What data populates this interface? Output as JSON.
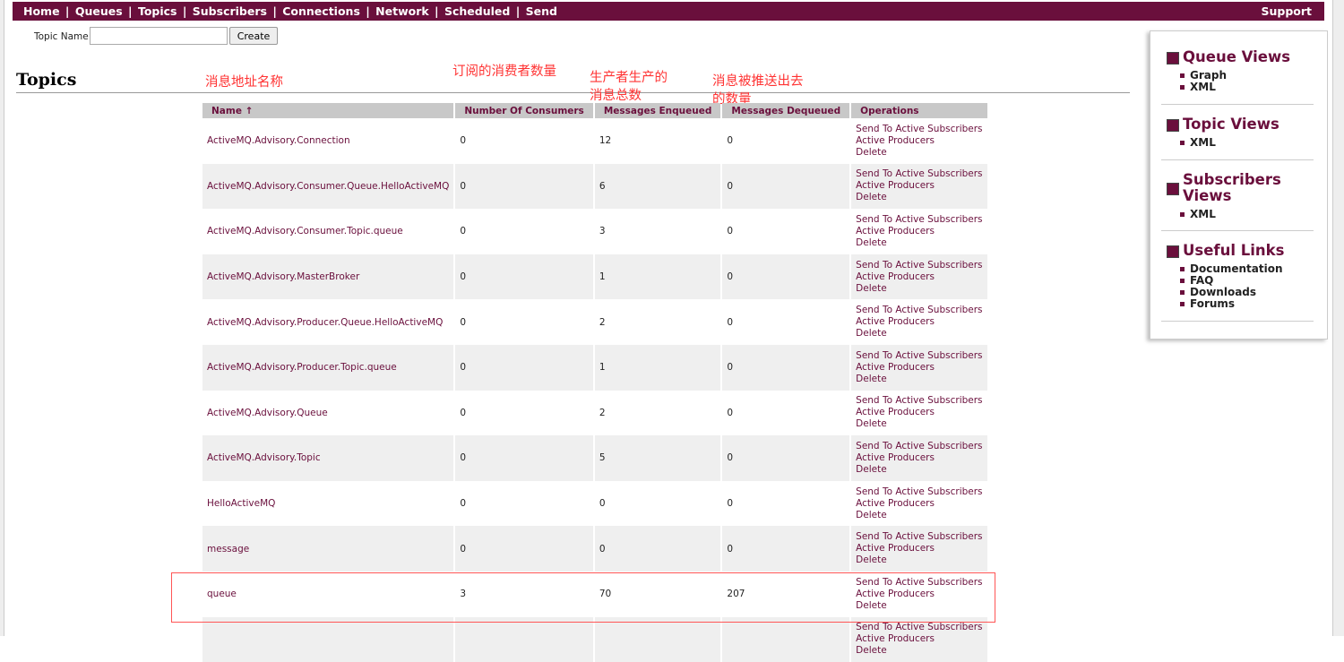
{
  "nav": {
    "items": [
      "Home",
      "Queues",
      "Topics",
      "Subscribers",
      "Connections",
      "Network",
      "Scheduled",
      "Send"
    ],
    "support": "Support"
  },
  "create_form": {
    "label": "Topic Name",
    "input_value": "",
    "button": "Create"
  },
  "page_title": "Topics",
  "annotations": {
    "name": "消息地址名称",
    "consumers": "订阅的消费者数量",
    "enqueued_line1": "生产者生产的",
    "enqueued_line2": "消息总数",
    "dequeued_line1": "消息被推送出去",
    "dequeued_line2": "的数量"
  },
  "table": {
    "headers": {
      "name": "Name ↑",
      "consumers": "Number Of Consumers",
      "enqueued": "Messages Enqueued",
      "dequeued": "Messages Dequeued",
      "operations": "Operations"
    },
    "ops_labels": [
      "Send To Active Subscribers",
      "Active Producers",
      "Delete"
    ],
    "rows": [
      {
        "name": "ActiveMQ.Advisory.Connection",
        "consumers": "0",
        "enqueued": "12",
        "dequeued": "0"
      },
      {
        "name": "ActiveMQ.Advisory.Consumer.Queue.HelloActiveMQ",
        "consumers": "0",
        "enqueued": "6",
        "dequeued": "0"
      },
      {
        "name": "ActiveMQ.Advisory.Consumer.Topic.queue",
        "consumers": "0",
        "enqueued": "3",
        "dequeued": "0"
      },
      {
        "name": "ActiveMQ.Advisory.MasterBroker",
        "consumers": "0",
        "enqueued": "1",
        "dequeued": "0"
      },
      {
        "name": "ActiveMQ.Advisory.Producer.Queue.HelloActiveMQ",
        "consumers": "0",
        "enqueued": "2",
        "dequeued": "0"
      },
      {
        "name": "ActiveMQ.Advisory.Producer.Topic.queue",
        "consumers": "0",
        "enqueued": "1",
        "dequeued": "0"
      },
      {
        "name": "ActiveMQ.Advisory.Queue",
        "consumers": "0",
        "enqueued": "2",
        "dequeued": "0"
      },
      {
        "name": "ActiveMQ.Advisory.Topic",
        "consumers": "0",
        "enqueued": "5",
        "dequeued": "0"
      },
      {
        "name": "HelloActiveMQ",
        "consumers": "0",
        "enqueued": "0",
        "dequeued": "0"
      },
      {
        "name": "message",
        "consumers": "0",
        "enqueued": "0",
        "dequeued": "0"
      },
      {
        "name": "queue",
        "consumers": "3",
        "enqueued": "70",
        "dequeued": "207"
      },
      {
        "name": "",
        "consumers": "",
        "enqueued": "",
        "dequeued": ""
      }
    ]
  },
  "sidebar": {
    "sections": [
      {
        "title": "Queue Views",
        "items": [
          "Graph",
          "XML"
        ]
      },
      {
        "title": "Topic Views",
        "items": [
          "XML"
        ]
      },
      {
        "title_line1": "Subscribers",
        "title_line2": "Views",
        "items": [
          "XML"
        ]
      },
      {
        "title": "Useful Links",
        "items": [
          "Documentation",
          "FAQ",
          "Downloads",
          "Forums"
        ]
      }
    ]
  },
  "colors": {
    "brand": "#6a0f3c",
    "annotation": "#ff3333",
    "header_bg": "#c8c8c8",
    "row_alt": "#efefef"
  }
}
